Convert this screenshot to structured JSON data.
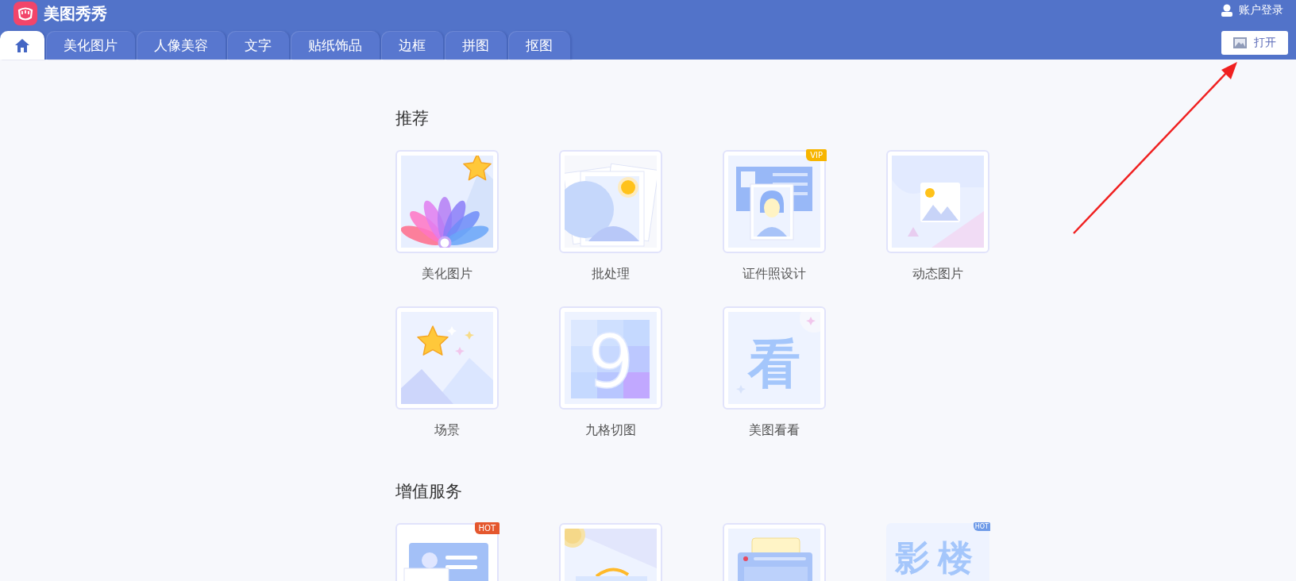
{
  "app": {
    "title": "美图秀秀",
    "account": "账户登录",
    "open_button": "打开"
  },
  "tabs": [
    {
      "kind": "home",
      "selected": true
    },
    {
      "kind": "text",
      "label": "美化图片",
      "selected": false
    },
    {
      "kind": "text",
      "label": "人像美容",
      "selected": false
    },
    {
      "kind": "text",
      "label": "文字",
      "selected": false
    },
    {
      "kind": "text",
      "label": "贴纸饰品",
      "selected": false
    },
    {
      "kind": "text",
      "label": "边框",
      "selected": false
    },
    {
      "kind": "text",
      "label": "拼图",
      "selected": false
    },
    {
      "kind": "text",
      "label": "抠图",
      "selected": false
    }
  ],
  "sections": [
    {
      "title": "推荐",
      "tiles": [
        {
          "label": "美化图片",
          "kind": "flower"
        },
        {
          "label": "批处理",
          "kind": "photos"
        },
        {
          "label": "证件照设计",
          "kind": "idcard",
          "badge": "VIP",
          "color": "#f7b500"
        },
        {
          "label": "动态图片",
          "kind": "gif"
        },
        {
          "label": "场景",
          "kind": "scene"
        },
        {
          "label": "九格切图",
          "kind": "grid9",
          "glyph": "9"
        },
        {
          "label": "美图看看",
          "kind": "look",
          "glyph": "看"
        }
      ]
    },
    {
      "title": "增值服务",
      "tiles": [
        {
          "kind": "idphoto",
          "badge": "HOT",
          "color": "#e4572e"
        },
        {
          "kind": "pdf"
        },
        {
          "kind": "printer"
        },
        {
          "kind": "studio",
          "glyph": "影楼",
          "badge": "HOT",
          "color": "#6f9be8"
        }
      ]
    }
  ],
  "annotation": {
    "kind": "arrow"
  }
}
